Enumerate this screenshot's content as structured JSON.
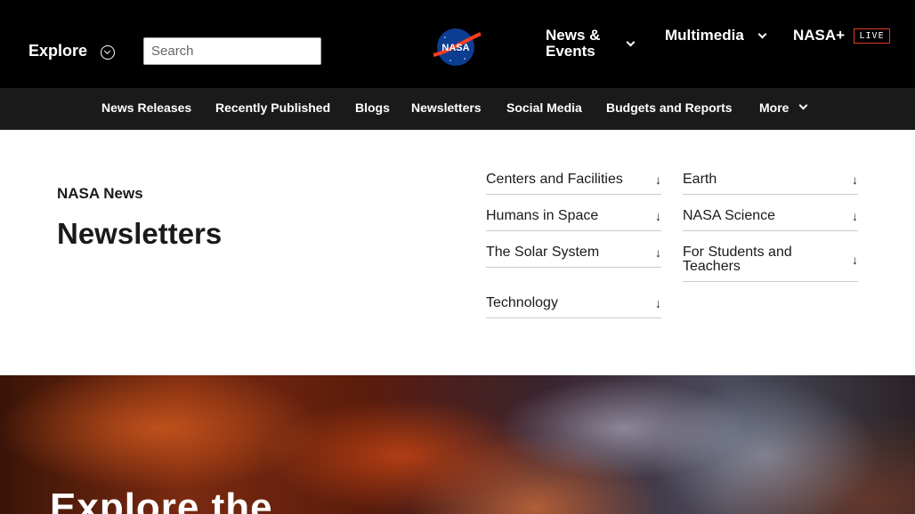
{
  "header": {
    "explore_label": "Explore",
    "search_placeholder": "Search",
    "logo_text": "NASA",
    "nav": [
      {
        "label": "News & Events"
      },
      {
        "label": "Multimedia"
      },
      {
        "label": "NASA+"
      }
    ],
    "live_badge": "LIVE"
  },
  "subnav": {
    "items": [
      {
        "label": "News Releases"
      },
      {
        "label": "Recently Published"
      },
      {
        "label": "Blogs"
      },
      {
        "label": "Newsletters"
      },
      {
        "label": "Social Media"
      },
      {
        "label": "Budgets and Reports"
      },
      {
        "label": "More"
      }
    ]
  },
  "main": {
    "eyebrow": "NASA News",
    "title": "Newsletters",
    "topics": [
      {
        "label": "Centers and Facilities"
      },
      {
        "label": "Earth"
      },
      {
        "label": "Humans in Space"
      },
      {
        "label": "NASA Science"
      },
      {
        "label": "The Solar System"
      },
      {
        "label": "For Students and Teachers"
      },
      {
        "label": "Technology"
      }
    ],
    "arrow_glyph": "↓"
  },
  "hero": {
    "title": "Explore the"
  },
  "colors": {
    "header_bg": "#000000",
    "subnav_bg": "#1a1a1a",
    "live_accent": "#e03c31",
    "nasa_blue": "#0b3d91",
    "nasa_red": "#fc3d21"
  }
}
